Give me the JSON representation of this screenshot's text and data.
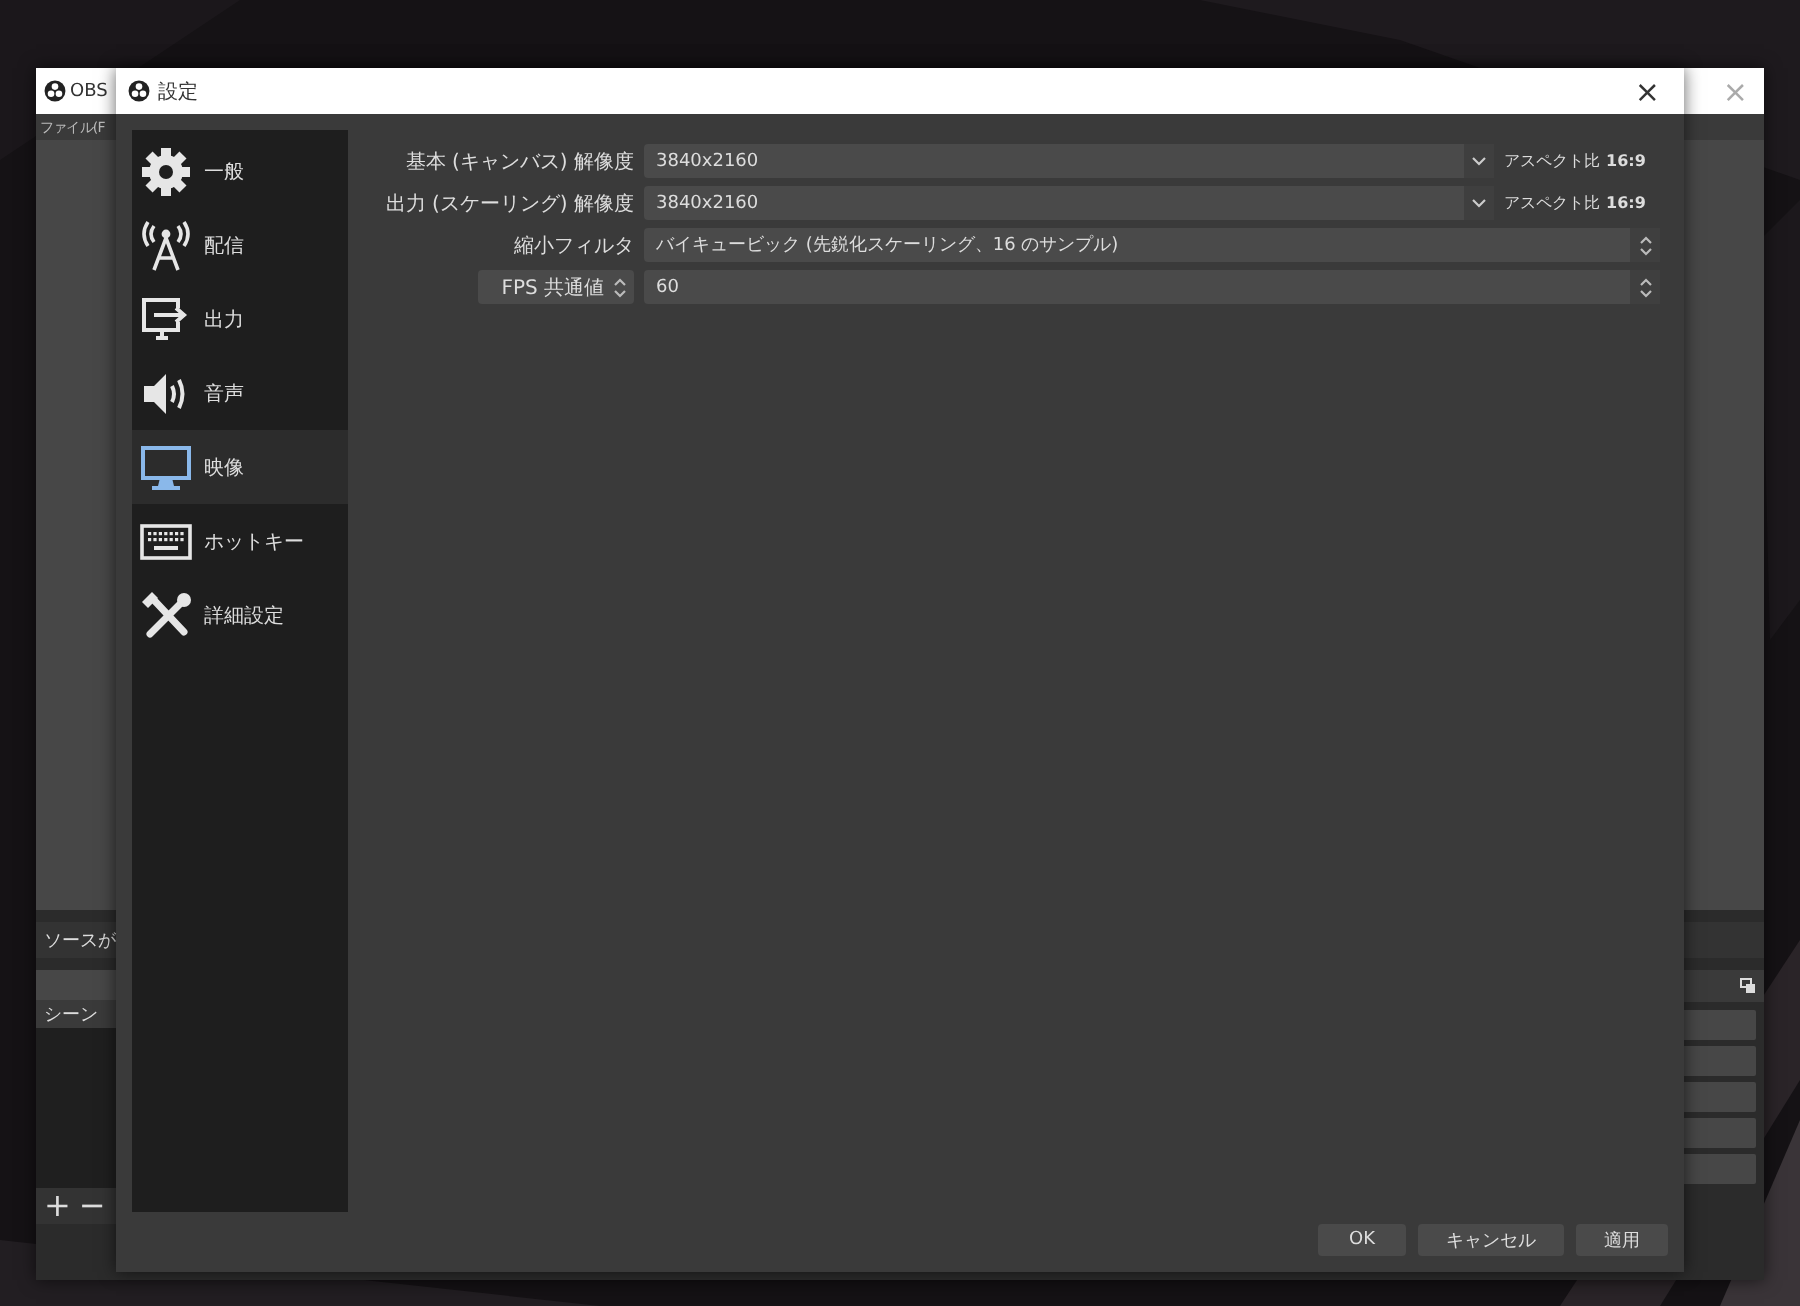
{
  "main_window": {
    "title": "OBS",
    "close": "×",
    "menu": [
      "ファイル(F"
    ],
    "sources_label": "ソースが",
    "scenes_header": "シーン",
    "scene_buttons": [
      "+",
      "−"
    ]
  },
  "dialog": {
    "title": "設定",
    "close": "×",
    "sidebar": [
      {
        "label": "一般",
        "selected": false
      },
      {
        "label": "配信",
        "selected": false
      },
      {
        "label": "出力",
        "selected": false
      },
      {
        "label": "音声",
        "selected": false
      },
      {
        "label": "映像",
        "selected": true
      },
      {
        "label": "ホットキー",
        "selected": false
      },
      {
        "label": "詳細設定",
        "selected": false
      }
    ],
    "rows": [
      {
        "kind": "combo",
        "label": "基本 (キャンバス) 解像度",
        "value": "3840x2160",
        "aspect": "アスペクト比 **16:9**"
      },
      {
        "kind": "combo",
        "label": "出力 (スケーリング) 解像度",
        "value": "3840x2160",
        "aspect": "アスペクト比 **16:9**"
      },
      {
        "kind": "select",
        "label": "縮小フィルタ",
        "value": "バイキュービック (先鋭化スケーリング、16 のサンプル)"
      },
      {
        "kind": "spin",
        "label": "FPS 共通値",
        "value": "60"
      }
    ],
    "buttons": [
      "OK",
      "キャンセル",
      "適用"
    ]
  }
}
